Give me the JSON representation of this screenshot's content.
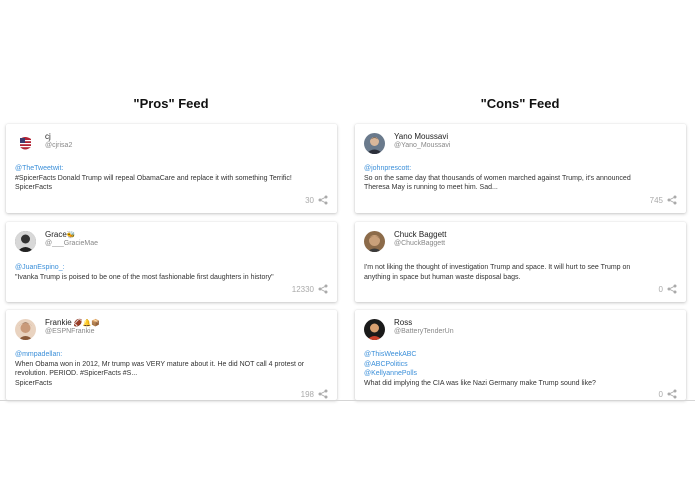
{
  "pros": {
    "title": "\"Pros\" Feed",
    "cards": [
      {
        "name": "cj",
        "handle": "@cjrisa2",
        "mentions": [
          "@TheTweetwit:"
        ],
        "lines": [
          "#SpicerFacts Donald Trump will repeal ObamaCare and replace it with something Terrific!",
          "SpicerFacts"
        ],
        "count": "30",
        "avatar_icon": "us-flag-avatar"
      },
      {
        "name": "Grace",
        "name_suffix": "🐝",
        "handle": "@___GracieMae",
        "mentions": [
          "@JuanEspino_:"
        ],
        "lines": [
          "\"Ivanka Trump is poised to be one of the most fashionable first daughters in history\""
        ],
        "count": "12330",
        "avatar_icon": "person-avatar"
      },
      {
        "name": "Frankie",
        "name_suffix": "🏈🔔📦",
        "handle": "@ESPNFrankie",
        "mentions": [
          "@mmpadellan:"
        ],
        "lines": [
          "When Obama won in 2012, Mr trump was VERY mature about it. He did NOT call 4 protest or",
          "revolution. PERIOD. #SpicerFacts #S...",
          "SpicerFacts"
        ],
        "count": "198",
        "avatar_icon": "person-avatar"
      }
    ]
  },
  "cons": {
    "title": "\"Cons\" Feed",
    "cards": [
      {
        "name": "Yano Moussavi",
        "handle": "@Yano_Moussavi",
        "mentions": [
          "@johnprescott:"
        ],
        "lines": [
          "So on the same day that thousands of women marched against Trump, it's announced",
          "Theresa May is running to meet him. Sad..."
        ],
        "count": "745",
        "avatar_icon": "person-avatar"
      },
      {
        "name": "Chuck Baggett",
        "handle": "@ChuckBaggett",
        "mentions": [],
        "lines": [
          "I'm not liking the thought of investigation Trump and space. It will hurt to see Trump on",
          "anything in space but human waste disposal bags."
        ],
        "count": "0",
        "avatar_icon": "person-avatar"
      },
      {
        "name": "Ross",
        "handle": "@BatteryTenderUn",
        "mentions": [
          "@ThisWeekABC",
          "@ABCPolitics",
          "@KellyannePolls"
        ],
        "lines": [
          "What did implying the CIA was like Nazi Germany make Trump sound like?"
        ],
        "count": "0",
        "avatar_icon": "person-avatar"
      }
    ]
  },
  "colors": {
    "mention": "#3b8fd9",
    "share": "#aaaaaa"
  }
}
